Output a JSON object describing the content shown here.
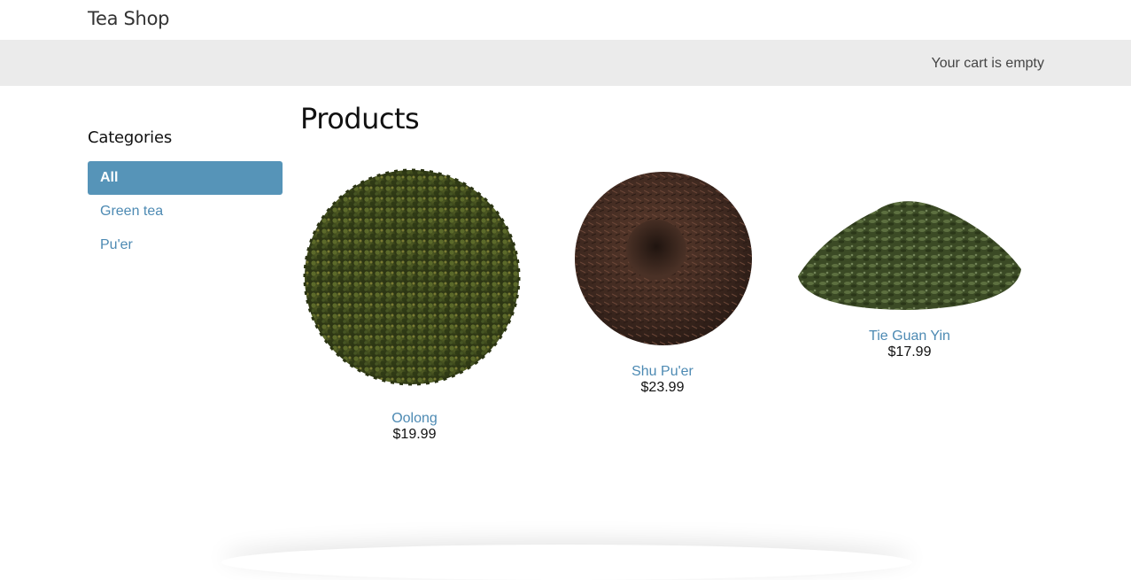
{
  "header": {
    "brand": "Tea Shop"
  },
  "cart": {
    "status": "Your cart is empty"
  },
  "sidebar": {
    "title": "Categories",
    "items": [
      {
        "label": "All",
        "active": true
      },
      {
        "label": "Green tea",
        "active": false
      },
      {
        "label": "Pu'er",
        "active": false
      }
    ]
  },
  "main": {
    "title": "Products",
    "products": [
      {
        "name": "Oolong",
        "price": "$19.99",
        "image": "loose-leaf-tea-circle"
      },
      {
        "name": "Shu Pu'er",
        "price": "$23.99",
        "image": "pressed-tea-cake"
      },
      {
        "name": "Tie Guan Yin",
        "price": "$17.99",
        "image": "loose-leaf-tea-pile"
      }
    ]
  },
  "colors": {
    "accent": "#5694b8",
    "link": "#4d8ab3",
    "cartbar": "#ebebeb"
  }
}
